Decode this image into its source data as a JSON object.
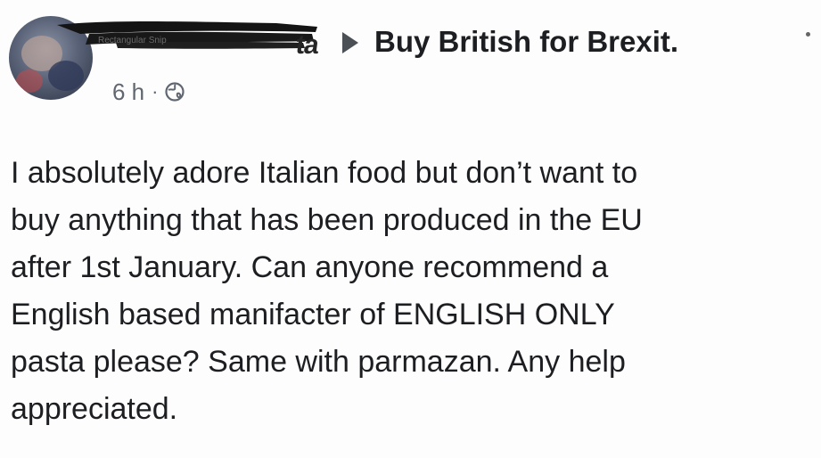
{
  "post": {
    "author_visible_fragment": "ta",
    "group_name": "Buy British for Brexit.",
    "timestamp": "6 h",
    "separator": "·",
    "privacy_icon": "globe-icon",
    "avatar_watermark": "Rectangular Snip",
    "body_lines": [
      "I absolutely adore Italian food but don’t want to",
      "buy anything that has been produced in the EU",
      "after 1st January. Can anyone recommend a",
      "English based manifacter of ENGLISH ONLY",
      "pasta please? Same with parmazan. Any help",
      "appreciated."
    ]
  }
}
